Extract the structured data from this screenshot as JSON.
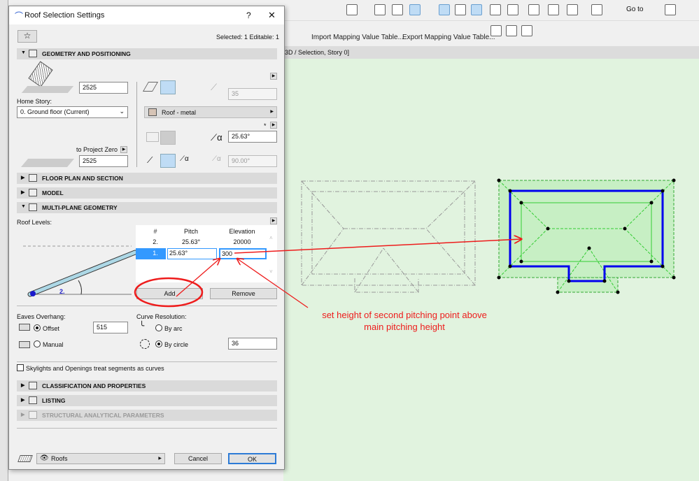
{
  "app": {
    "toolbar": {
      "goto_label": "Go to",
      "import_label": "Import Mapping Value Table...",
      "export_label": "Export Mapping Value Table..."
    },
    "view_tab": "3D / Selection, Story 0]"
  },
  "dialog": {
    "title": "Roof Selection Settings",
    "help": "?",
    "close": "✕",
    "selection_info": "Selected: 1 Editable: 1",
    "sections": {
      "geometry": "GEOMETRY AND POSITIONING",
      "floor_plan": "FLOOR PLAN AND SECTION",
      "model": "MODEL",
      "multi_plane": "MULTI-PLANE GEOMETRY",
      "classification": "CLASSIFICATION AND PROPERTIES",
      "listing": "LISTING",
      "structural": "STRUCTURAL ANALYTICAL PARAMETERS"
    },
    "geometry": {
      "top_value": "2525",
      "home_story_label": "Home Story:",
      "home_story_value": "0. Ground floor (Current)",
      "to_project_zero_label": "to Project Zero",
      "bottom_value": "2525",
      "thickness_value": "35",
      "material": "Roof - metal",
      "pitch_value": "25.63°",
      "angle_value": "90.00°",
      "asterisk": "*"
    },
    "multi_plane": {
      "roof_levels_label": "Roof Levels:",
      "diagram_label": "2.",
      "table": {
        "headers": [
          "#",
          "Pitch",
          "Elevation"
        ],
        "rows": [
          {
            "num": "2.",
            "pitch": "25.63°",
            "elevation": "20000"
          },
          {
            "num": "1.",
            "pitch": "25.63°",
            "elevation": "300"
          }
        ]
      },
      "add_label": "Add",
      "remove_label": "Remove",
      "eaves_label": "Eaves Overhang:",
      "offset_label": "Offset",
      "offset_value": "515",
      "manual_label": "Manual",
      "offset_selected": true,
      "curve_label": "Curve Resolution:",
      "by_arc_label": "By arc",
      "by_circle_label": "By circle",
      "circle_value": "36",
      "by_circle_selected": true,
      "skylights_label": "Skylights and Openings treat segments as curves",
      "skylights_checked": false
    },
    "footer": {
      "layer": "Roofs",
      "cancel": "Cancel",
      "ok": "OK"
    }
  },
  "annotation": {
    "note_line1": "set height of second pitching point above",
    "note_line2": "main pitching height",
    "color": "#ee1c1c"
  },
  "colors": {
    "canvas": "#e1f3df",
    "selected_fill": "#c7efc4",
    "selected_outline": "#0000ee",
    "selection_accent": "#3399ff"
  }
}
